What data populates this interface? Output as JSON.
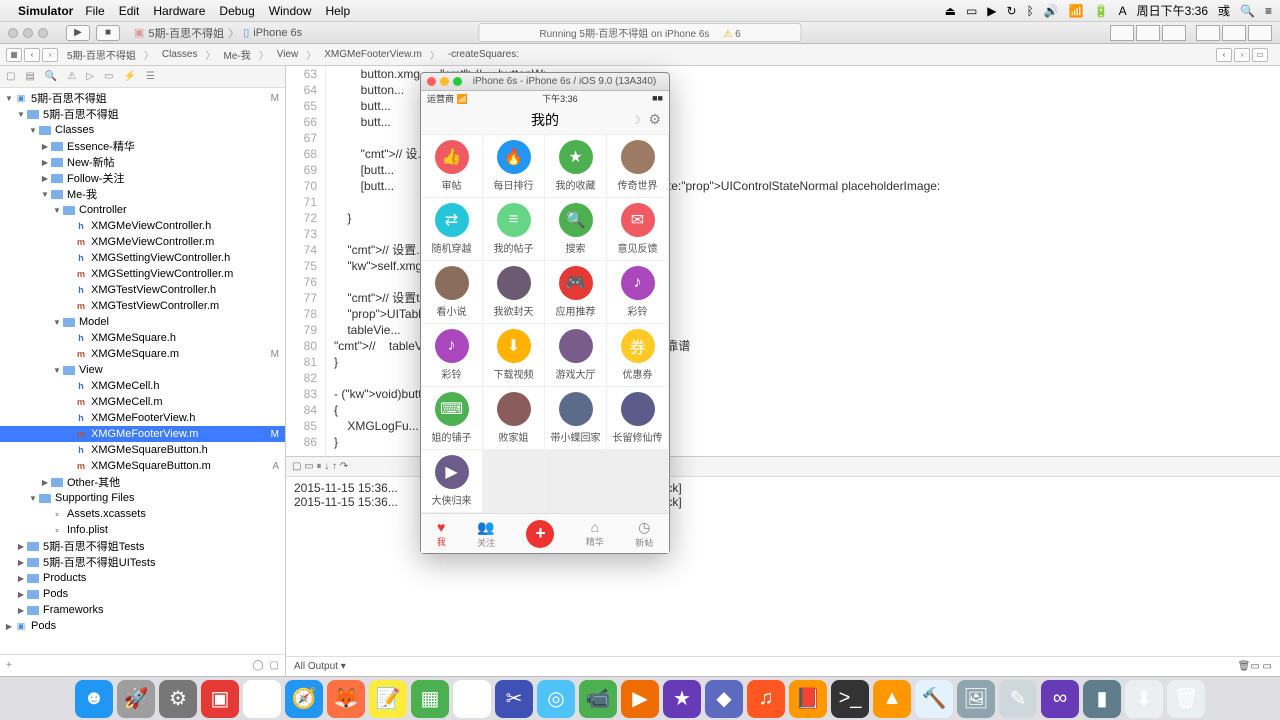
{
  "menubar": {
    "app": "Simulator",
    "items": [
      "File",
      "Edit",
      "Hardware",
      "Debug",
      "Window",
      "Help"
    ],
    "clock": "周日下午3:36",
    "user": "彧"
  },
  "toolbar": {
    "scheme": "5期-百思不得姐",
    "device": "iPhone 6s",
    "status": "Running 5期-百思不得姐 on iPhone 6s",
    "issues": "6"
  },
  "jumpbar": {
    "crumbs": [
      "5期-百思不得姐",
      "Classes",
      "Me-我",
      "View",
      "XMGMeFooterView.m",
      "-createSquares:"
    ]
  },
  "navigator": {
    "tree": [
      {
        "d": 0,
        "t": "proj",
        "n": "5期-百思不得姐",
        "s": "M"
      },
      {
        "d": 1,
        "t": "fold",
        "n": "5期-百思不得姐"
      },
      {
        "d": 2,
        "t": "fold",
        "n": "Classes"
      },
      {
        "d": 3,
        "t": "fold",
        "n": "Essence-精华",
        "c": true
      },
      {
        "d": 3,
        "t": "fold",
        "n": "New-新帖",
        "c": true
      },
      {
        "d": 3,
        "t": "fold",
        "n": "Follow-关注",
        "c": true
      },
      {
        "d": 3,
        "t": "fold",
        "n": "Me-我"
      },
      {
        "d": 4,
        "t": "fold",
        "n": "Controller"
      },
      {
        "d": 5,
        "t": "h",
        "n": "XMGMeViewController.h"
      },
      {
        "d": 5,
        "t": "m",
        "n": "XMGMeViewController.m"
      },
      {
        "d": 5,
        "t": "h",
        "n": "XMGSettingViewController.h"
      },
      {
        "d": 5,
        "t": "m",
        "n": "XMGSettingViewController.m"
      },
      {
        "d": 5,
        "t": "h",
        "n": "XMGTestViewController.h"
      },
      {
        "d": 5,
        "t": "m",
        "n": "XMGTestViewController.m"
      },
      {
        "d": 4,
        "t": "fold",
        "n": "Model"
      },
      {
        "d": 5,
        "t": "h",
        "n": "XMGMeSquare.h"
      },
      {
        "d": 5,
        "t": "m",
        "n": "XMGMeSquare.m",
        "s": "M"
      },
      {
        "d": 4,
        "t": "fold",
        "n": "View"
      },
      {
        "d": 5,
        "t": "h",
        "n": "XMGMeCell.h"
      },
      {
        "d": 5,
        "t": "m",
        "n": "XMGMeCell.m"
      },
      {
        "d": 5,
        "t": "h",
        "n": "XMGMeFooterView.h"
      },
      {
        "d": 5,
        "t": "m",
        "n": "XMGMeFooterView.m",
        "sel": true,
        "s": "M"
      },
      {
        "d": 5,
        "t": "h",
        "n": "XMGMeSquareButton.h"
      },
      {
        "d": 5,
        "t": "m",
        "n": "XMGMeSquareButton.m",
        "s": "A"
      },
      {
        "d": 3,
        "t": "fold",
        "n": "Other-其他",
        "c": true
      },
      {
        "d": 2,
        "t": "fold",
        "n": "Supporting Files"
      },
      {
        "d": 3,
        "t": "res",
        "n": "Assets.xcassets"
      },
      {
        "d": 3,
        "t": "res",
        "n": "Info.plist"
      },
      {
        "d": 1,
        "t": "fold",
        "n": "5期-百思不得姐Tests",
        "c": true
      },
      {
        "d": 1,
        "t": "fold",
        "n": "5期-百思不得姐UITests",
        "c": true
      },
      {
        "d": 1,
        "t": "fold",
        "n": "Products",
        "c": true
      },
      {
        "d": 1,
        "t": "fold",
        "n": "Pods",
        "c": true
      },
      {
        "d": 1,
        "t": "fold",
        "n": "Frameworks",
        "c": true
      },
      {
        "d": 0,
        "t": "proj",
        "n": "Pods",
        "c": true
      }
    ]
  },
  "editor": {
    "first_line": 63,
    "lines": [
      "        button.xmg_... // ... buttonW;",
      "        button...             ...   buttonH;",
      "        butt...",
      "        butt...",
      "",
      "        // 设...",
      "        [butt...                           ...te:UIControlStateNormal];",
      "        [butt...                           ...RLWithString:square.icon] forState:UIControlStateNormal placeholderImage:",
      "                                            ...d-default\"]];",
      "    }",
      "",
      "    // 设置...                     ...最大Y值)",
      "    self.xmg...                   ...ect.xmg_bottom;",
      "",
      "    // 设置ta...",
      "    UITableV...                   ...)self.superview;",
      "    tableVie...",
      "//    tableVi...                    ... self.xmg_bottom); // 不靠谱",
      "}",
      "",
      "- (void)butt...                    ...tton",
      "{",
      "    XMGLogFu...",
      "}"
    ]
  },
  "console": {
    "filter": "All Output",
    "lines": [
      "2015-11-15 15:36...                 ...43] -[XMGMeViewController settingClick]",
      "2015-11-15 15:36...                 ...43] -[XMGMeViewController settingClick]"
    ]
  },
  "simulator": {
    "title": "iPhone 6s - iPhone 6s / iOS 9.0 (13A340)",
    "carrier": "运营商",
    "time": "下午3:36",
    "nav_title": "我的",
    "squares": [
      {
        "label": "审帖",
        "icon": "👍",
        "bg": "#f05a63"
      },
      {
        "label": "每日排行",
        "icon": "🔥",
        "bg": "#2196f3"
      },
      {
        "label": "我的收藏",
        "icon": "★",
        "bg": "#4caf50"
      },
      {
        "label": "传奇世界",
        "icon": "",
        "bg": "#9c7a63"
      },
      {
        "label": "随机穿越",
        "icon": "⇄",
        "bg": "#26c6da"
      },
      {
        "label": "我的帖子",
        "icon": "≡",
        "bg": "#66d686"
      },
      {
        "label": "搜索",
        "icon": "🔍",
        "bg": "#4caf50"
      },
      {
        "label": "意见反馈",
        "icon": "✉",
        "bg": "#f05a63"
      },
      {
        "label": "看小说",
        "icon": "",
        "bg": "#8a6d5c"
      },
      {
        "label": "我欲封天",
        "icon": "",
        "bg": "#6b5a72"
      },
      {
        "label": "应用推荐",
        "icon": "🎮",
        "bg": "#e53935"
      },
      {
        "label": "彩铃",
        "icon": "♪",
        "bg": "#ab47bc"
      },
      {
        "label": "彩铃",
        "icon": "♪",
        "bg": "#ab47bc"
      },
      {
        "label": "下载视频",
        "icon": "⬇",
        "bg": "#ffb300"
      },
      {
        "label": "游戏大厅",
        "icon": "",
        "bg": "#7a5c8a"
      },
      {
        "label": "优惠券",
        "icon": "券",
        "bg": "#ffca28"
      },
      {
        "label": "姐的铺子",
        "icon": "⌨",
        "bg": "#4caf50"
      },
      {
        "label": "败家姐",
        "icon": "",
        "bg": "#8a5c5c"
      },
      {
        "label": "带小蝶回家",
        "icon": "",
        "bg": "#5c6b8a"
      },
      {
        "label": "长留修仙传",
        "icon": "",
        "bg": "#5c5c8a"
      },
      {
        "label": "大侠归来",
        "icon": "▶",
        "bg": "#6b5c8a"
      }
    ],
    "tabs": [
      {
        "label": "我",
        "icon": "♥",
        "active": true
      },
      {
        "label": "关注",
        "icon": "👥"
      },
      {
        "label": "",
        "plus": true
      },
      {
        "label": "精华",
        "icon": "⌂"
      },
      {
        "label": "新帖",
        "icon": "◷"
      }
    ]
  },
  "dock": {
    "apps": [
      {
        "n": "finder",
        "bg": "#2196f3",
        "g": "☻"
      },
      {
        "n": "launchpad",
        "bg": "#9e9e9e",
        "g": "🚀"
      },
      {
        "n": "settings",
        "bg": "#777",
        "g": "⚙"
      },
      {
        "n": "activity",
        "bg": "#e53935",
        "g": "▣"
      },
      {
        "n": "chrome",
        "bg": "#fff",
        "g": "◉"
      },
      {
        "n": "safari",
        "bg": "#2196f3",
        "g": "🧭"
      },
      {
        "n": "firefox",
        "bg": "#ff7043",
        "g": "🦊"
      },
      {
        "n": "notes",
        "bg": "#ffeb3b",
        "g": "📝"
      },
      {
        "n": "numbers",
        "bg": "#4caf50",
        "g": "▦"
      },
      {
        "n": "photos",
        "bg": "#fff",
        "g": "✿"
      },
      {
        "n": "fcpx",
        "bg": "#3f51b5",
        "g": "✂"
      },
      {
        "n": "screen",
        "bg": "#4fc3f7",
        "g": "◎"
      },
      {
        "n": "facetime",
        "bg": "#4caf50",
        "g": "📹"
      },
      {
        "n": "keynote",
        "bg": "#ef6c00",
        "g": "▶"
      },
      {
        "n": "imovie",
        "bg": "#673ab7",
        "g": "★"
      },
      {
        "n": "app",
        "bg": "#5c6bc0",
        "g": "◆"
      },
      {
        "n": "music",
        "bg": "#ff5722",
        "g": "♫"
      },
      {
        "n": "ibooks",
        "bg": "#ff9800",
        "g": "📕"
      },
      {
        "n": "terminal",
        "bg": "#333",
        "g": ">_"
      },
      {
        "n": "vlc",
        "bg": "#ff9800",
        "g": "▲"
      },
      {
        "n": "xcode",
        "bg": "#e3f2fd",
        "g": "🔨"
      },
      {
        "n": "preview",
        "bg": "#90a4ae",
        "g": "🖼"
      },
      {
        "n": "texted",
        "bg": "#cfd8dc",
        "g": "✎"
      },
      {
        "n": "vs",
        "bg": "#673ab7",
        "g": "∞"
      },
      {
        "n": "app2",
        "bg": "#607d8b",
        "g": "▮"
      },
      {
        "n": "dl",
        "bg": "#eceff1",
        "g": "⬇"
      },
      {
        "n": "trash",
        "bg": "#eceff1",
        "g": "🗑"
      }
    ]
  }
}
